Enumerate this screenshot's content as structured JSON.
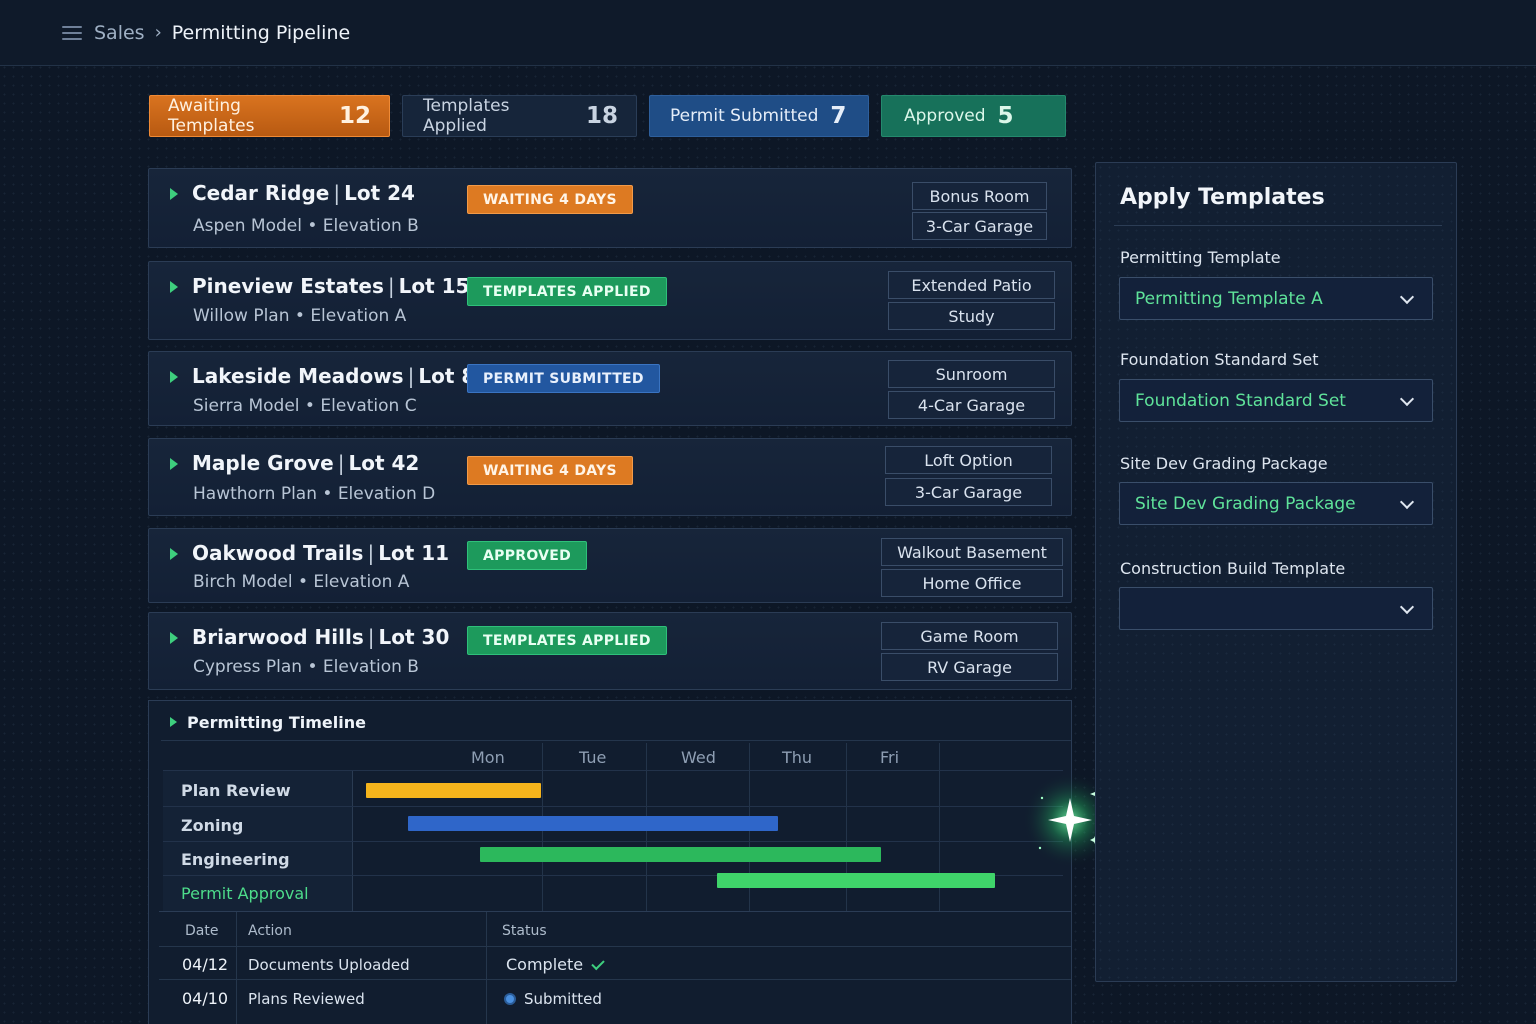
{
  "breadcrumb": {
    "root": "Sales",
    "current": "Permitting Pipeline"
  },
  "stage_tabs": [
    {
      "label": "Awaiting Templates",
      "count": "12"
    },
    {
      "label": "Templates Applied",
      "count": "18"
    },
    {
      "label": "Permit Submitted",
      "count": "7"
    },
    {
      "label": "Approved",
      "count": "5"
    }
  ],
  "lots": [
    {
      "community": "Cedar Ridge",
      "lot": "Lot 24",
      "plan": "Aspen Model • Elevation B",
      "status": "WAITING 4 DAYS",
      "options": [
        "Bonus Room",
        "3-Car Garage"
      ]
    },
    {
      "community": "Pineview Estates",
      "lot": "Lot 15",
      "plan": "Willow Plan • Elevation A",
      "status": "TEMPLATES APPLIED",
      "options": [
        "Extended Patio",
        "Study"
      ]
    },
    {
      "community": "Lakeside Meadows",
      "lot": "Lot 8",
      "plan": "Sierra Model • Elevation C",
      "status": "PERMIT SUBMITTED",
      "options": [
        "Sunroom",
        "4-Car Garage"
      ]
    },
    {
      "community": "Maple Grove",
      "lot": "Lot 42",
      "plan": "Hawthorn Plan • Elevation D",
      "status": "WAITING 4 DAYS",
      "options": [
        "Loft Option",
        "3-Car Garage"
      ]
    },
    {
      "community": "Oakwood Trails",
      "lot": "Lot 11",
      "plan": "Birch Model • Elevation A",
      "status": "APPROVED",
      "options": [
        "Walkout Basement",
        "Home Office"
      ]
    },
    {
      "community": "Briarwood Hills",
      "lot": "Lot 30",
      "plan": "Cypress Plan • Elevation B",
      "status": "TEMPLATES APPLIED",
      "options": [
        "Game Room",
        "RV Garage"
      ]
    }
  ],
  "timeline": {
    "title": "Permitting Timeline",
    "days": [
      "Mon",
      "Tue",
      "Wed",
      "Thu",
      "Fri"
    ],
    "tasks": [
      {
        "name": "Plan Review",
        "start": 0.1,
        "end": 1.8,
        "color": "#f5b41c"
      },
      {
        "name": "Zoning",
        "start": 0.5,
        "end": 4.1,
        "color": "#2f66c9"
      },
      {
        "name": "Engineering",
        "start": 1.2,
        "end": 5.1,
        "color": "#2cb85c"
      },
      {
        "name": "Permit Approval",
        "start": 3.5,
        "end": 6.2,
        "color": "#3fd46a"
      }
    ]
  },
  "activity": {
    "headers": {
      "date": "Date",
      "action": "Action",
      "status": "Status"
    },
    "rows": [
      {
        "date": "04/12",
        "action": "Documents Uploaded",
        "status": "Complete"
      },
      {
        "date": "04/10",
        "action": "Plans Reviewed",
        "status": "Submitted"
      }
    ]
  },
  "apply_panel": {
    "title": "Apply Templates",
    "fields": [
      {
        "label": "Permitting Template",
        "value": "Permitting Template A"
      },
      {
        "label": "Foundation Standard Set",
        "value": "Foundation Standard Set"
      },
      {
        "label": "Site Dev Grading Package",
        "value": "Site Dev Grading Package"
      },
      {
        "label": "Construction Build Template",
        "value": ""
      }
    ]
  }
}
